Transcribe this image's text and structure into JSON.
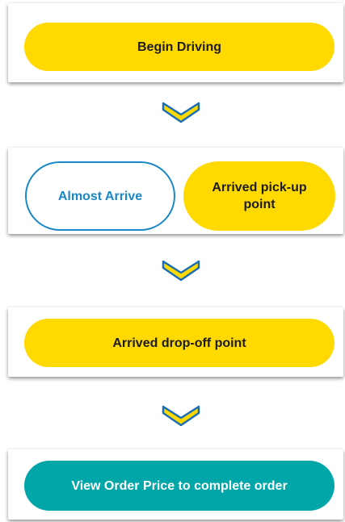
{
  "steps": {
    "begin_driving": "Begin Driving",
    "almost_arrive": "Almost Arrive",
    "arrived_pickup": "Arrived pick-up point",
    "arrived_dropoff": "Arrived drop-off point",
    "view_order_price": "View Order Price to complete order"
  },
  "colors": {
    "yellow": "#FFD900",
    "teal": "#00A6A8",
    "outline_blue": "#1A88C6",
    "chevron_stroke": "#1C6FB5"
  },
  "icons": {
    "step_arrow": "chevron-down-icon"
  }
}
